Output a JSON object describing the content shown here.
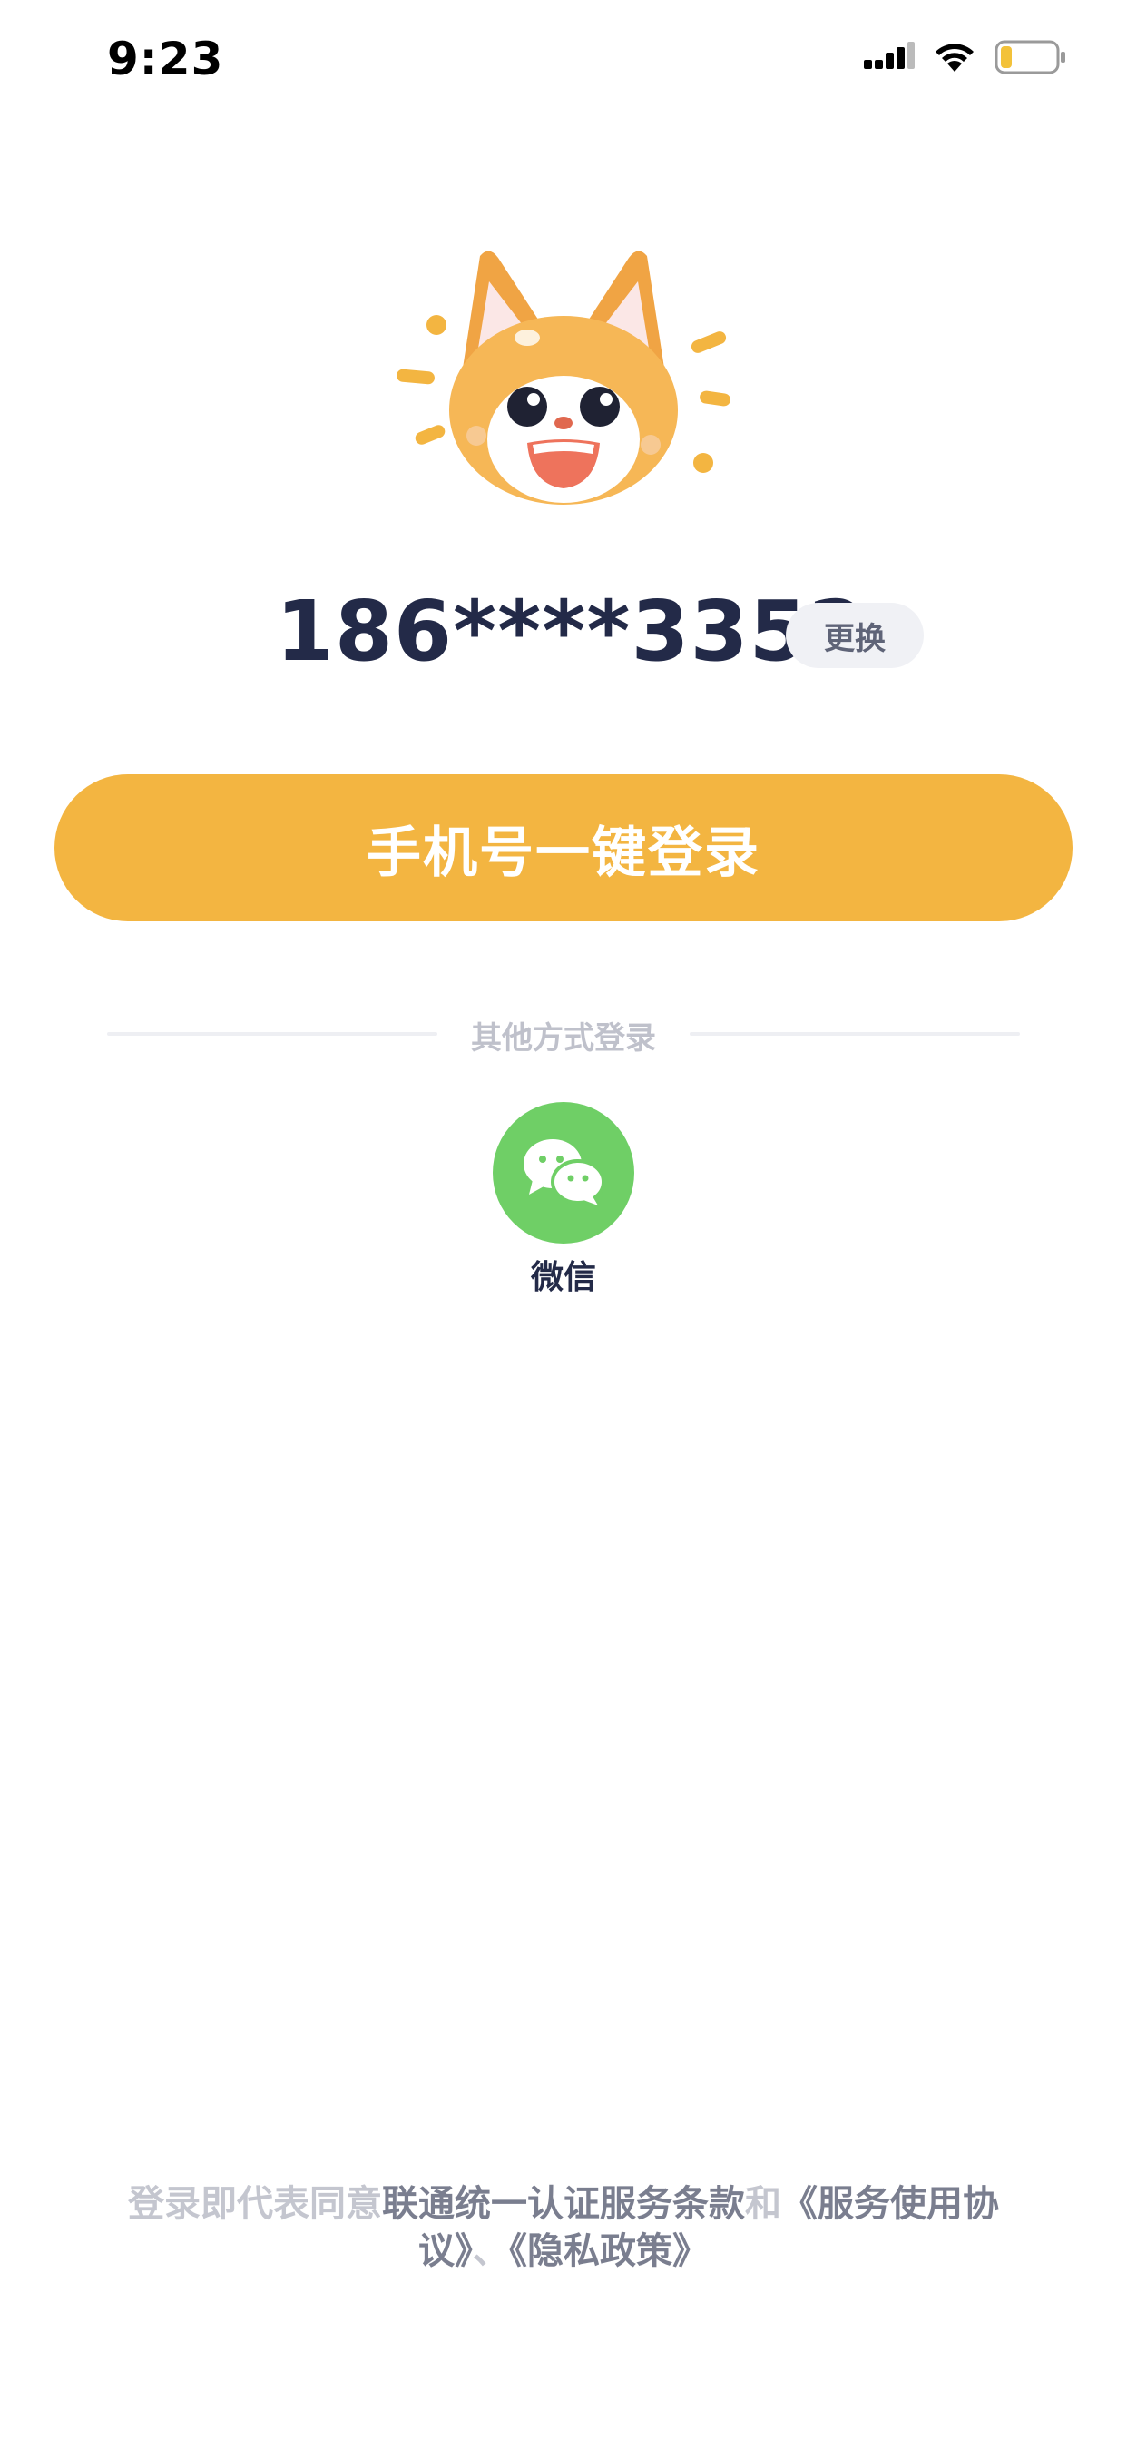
{
  "status_bar": {
    "time": "9:23",
    "icons": [
      "signal-icon",
      "wifi-icon",
      "battery-icon"
    ]
  },
  "mascot": {
    "icon": "fox-mascot-icon"
  },
  "phone": {
    "number": "186****3352",
    "change_label": "更换"
  },
  "login_button": {
    "label": "手机号一键登录"
  },
  "other_login": {
    "label": "其他方式登录",
    "wechat_label": "微信",
    "wechat_icon": "wechat-icon"
  },
  "agreement": {
    "prefix": "登录即代表同意",
    "carrier_terms": "联通统一认证服务条款",
    "and": "和",
    "service_agreement": "《服务使用协议》",
    "separator": "、",
    "privacy_policy": "《隐私政策》"
  },
  "colors": {
    "primary": "#f3b541",
    "wechat_green": "#6fcf66",
    "text_dark": "#232a48",
    "text_muted": "#c4c6cf",
    "link_text": "#7a7e8f"
  }
}
